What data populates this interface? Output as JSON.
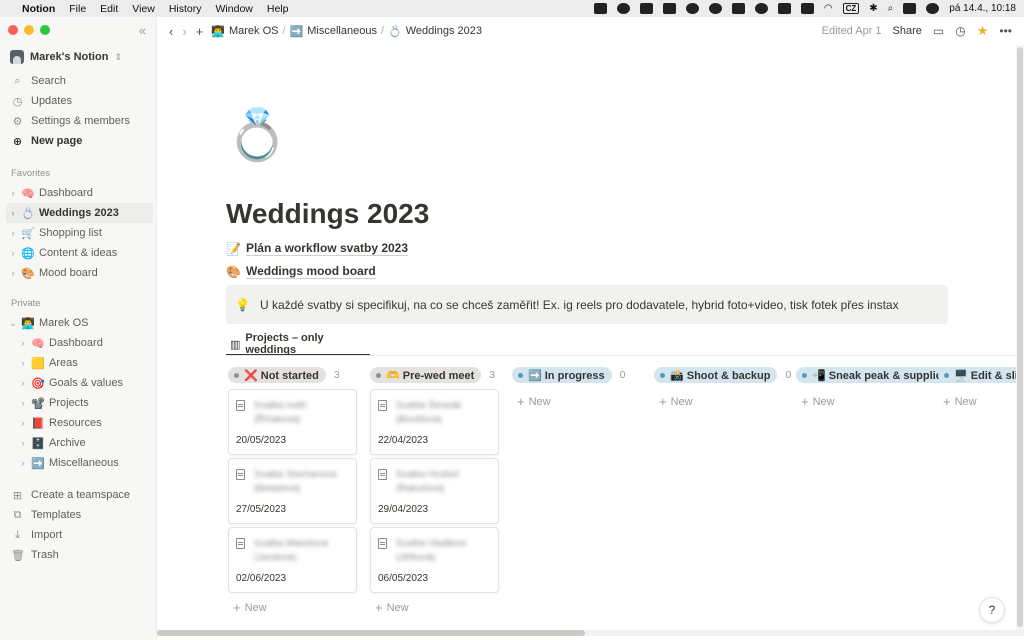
{
  "menubar": {
    "app_name": "Notion",
    "items": [
      "File",
      "Edit",
      "View",
      "History",
      "Window",
      "Help"
    ],
    "keyboard": "CZ",
    "clock": "pá 14.4., 10:18"
  },
  "sidebar": {
    "workspace": "Marek's Notion",
    "nav": [
      {
        "label": "Search",
        "icon": "search-icon"
      },
      {
        "label": "Updates",
        "icon": "clock-icon"
      },
      {
        "label": "Settings & members",
        "icon": "gear-icon"
      },
      {
        "label": "New page",
        "icon": "plus-circle-icon"
      }
    ],
    "favorites_label": "Favorites",
    "favorites": [
      {
        "emoji": "🧠",
        "label": "Dashboard"
      },
      {
        "emoji": "💍",
        "label": "Weddings 2023"
      },
      {
        "emoji": "🛒",
        "label": "Shopping list"
      },
      {
        "emoji": "🌐",
        "label": "Content & ideas"
      },
      {
        "emoji": "🎨",
        "label": "Mood board"
      }
    ],
    "private_label": "Private",
    "private_root": {
      "emoji": "👨‍💻",
      "label": "Marek OS"
    },
    "private_children": [
      {
        "emoji": "🧠",
        "label": "Dashboard"
      },
      {
        "emoji": "🟨",
        "label": "Areas"
      },
      {
        "emoji": "🎯",
        "label": "Goals & values"
      },
      {
        "emoji": "📽️",
        "label": "Projects"
      },
      {
        "emoji": "📕",
        "label": "Resources"
      },
      {
        "emoji": "🗄️",
        "label": "Archive"
      },
      {
        "emoji": "➡️",
        "label": "Miscellaneous"
      }
    ],
    "bottom": [
      {
        "label": "Create a teamspace",
        "icon": "teamspace-icon"
      },
      {
        "label": "Templates",
        "icon": "templates-icon"
      },
      {
        "label": "Import",
        "icon": "import-icon"
      },
      {
        "label": "Trash",
        "icon": "trash-icon"
      }
    ]
  },
  "topbar": {
    "breadcrumbs": [
      {
        "emoji": "👨‍💻",
        "label": "Marek OS"
      },
      {
        "emoji": "➡️",
        "label": "Miscellaneous"
      },
      {
        "emoji": "💍",
        "label": "Weddings 2023"
      }
    ],
    "edited": "Edited Apr 1",
    "share": "Share"
  },
  "page": {
    "icon": "💍",
    "title": "Weddings 2023",
    "links": [
      {
        "emoji": "📝",
        "label": "Plán a workflow svatby 2023"
      },
      {
        "emoji": "🎨",
        "label": "Weddings mood board"
      }
    ],
    "callout": {
      "emoji": "💡",
      "text": "U každé svatby si specifikuj, na co se chceš zaměřit! Ex. ig reels pro dodavatele, hybrid foto+video, tisk fotek přes instax"
    },
    "view_tab": "Projects – only weddings"
  },
  "board": {
    "columns": [
      {
        "label": "❌ Not started",
        "count": "3",
        "color": "#e3e2e0",
        "dot": "#91918e",
        "cards": [
          {
            "title": "Svatba Iveth (Říhaková)",
            "date": "20/05/2023"
          },
          {
            "title": "Svatba Stechanová (Betadová)",
            "date": "27/05/2023"
          },
          {
            "title": "Svatba Marešová (Jandová)",
            "date": "02/06/2023"
          }
        ]
      },
      {
        "label": "🫶 Pre-wed meet",
        "count": "3",
        "color": "#e3e2e0",
        "dot": "#91918e",
        "cards": [
          {
            "title": "Svatba Šerarák (Bouřilová)",
            "date": "22/04/2023"
          },
          {
            "title": "Svatba Hrubeš (Rakušová)",
            "date": "29/04/2023"
          },
          {
            "title": "Svatba Vladikovi (Jiříková)",
            "date": "06/05/2023"
          }
        ]
      },
      {
        "label": "➡️ In progress",
        "count": "0",
        "color": "#d3e5ef",
        "dot": "#5b97bd",
        "cards": []
      },
      {
        "label": "📸 Shoot & backup",
        "count": "0",
        "color": "#d3e5ef",
        "dot": "#5b97bd",
        "cards": []
      },
      {
        "label": "📲 Sneak peak & suppliers",
        "count": "",
        "color": "#d3e5ef",
        "dot": "#5b97bd",
        "cards": []
      },
      {
        "label": "🖥️ Edit & slide",
        "count": "",
        "color": "#d3e5ef",
        "dot": "#5b97bd",
        "cards": []
      }
    ],
    "new_label": "New"
  },
  "help_label": "?"
}
